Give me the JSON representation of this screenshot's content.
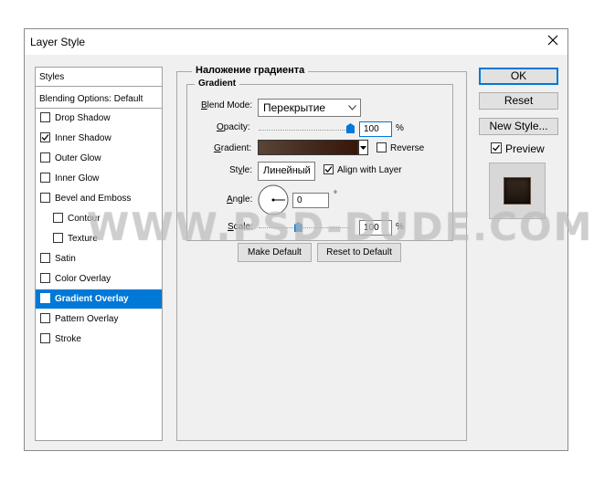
{
  "window": {
    "title": "Layer Style"
  },
  "sidebar": {
    "header": "Styles",
    "blending": "Blending Options: Default",
    "items": [
      {
        "label": "Drop Shadow",
        "checked": false,
        "selected": false,
        "indent": false
      },
      {
        "label": "Inner Shadow",
        "checked": true,
        "selected": false,
        "indent": false
      },
      {
        "label": "Outer Glow",
        "checked": false,
        "selected": false,
        "indent": false
      },
      {
        "label": "Inner Glow",
        "checked": false,
        "selected": false,
        "indent": false
      },
      {
        "label": "Bevel and Emboss",
        "checked": false,
        "selected": false,
        "indent": false
      },
      {
        "label": "Contour",
        "checked": false,
        "selected": false,
        "indent": true
      },
      {
        "label": "Texture",
        "checked": false,
        "selected": false,
        "indent": true
      },
      {
        "label": "Satin",
        "checked": false,
        "selected": false,
        "indent": false
      },
      {
        "label": "Color Overlay",
        "checked": false,
        "selected": false,
        "indent": false
      },
      {
        "label": "Gradient Overlay",
        "checked": true,
        "selected": true,
        "indent": false
      },
      {
        "label": "Pattern Overlay",
        "checked": false,
        "selected": false,
        "indent": false
      },
      {
        "label": "Stroke",
        "checked": false,
        "selected": false,
        "indent": false
      }
    ]
  },
  "panel": {
    "title": "Наложение градиента",
    "group_title": "Gradient",
    "blend_mode": {
      "label": "Blend Mode:",
      "value": "Перекрытие"
    },
    "opacity": {
      "label": "Opacity:",
      "value": "100",
      "unit": "%",
      "fraction": 1.0
    },
    "gradient": {
      "label": "Gradient:",
      "reverse_label": "Reverse",
      "reverse": false
    },
    "style": {
      "label": "Style:",
      "value": "Линейный",
      "align_label": "Align with Layer",
      "align": true
    },
    "angle": {
      "label": "Angle:",
      "value": "0",
      "unit": "°"
    },
    "scale": {
      "label": "Scale:",
      "value": "100",
      "unit": "%",
      "fraction": 0.43
    },
    "make_default": "Make Default",
    "reset_default": "Reset to Default"
  },
  "buttons": {
    "ok": "OK",
    "reset": "Reset",
    "new_style": "New Style...",
    "preview": "Preview",
    "preview_checked": true
  },
  "watermark": "WWW.PSD-DUDE.COM",
  "colors": {
    "accent": "#0078d7",
    "gradient_start": "#5a4536",
    "gradient_end": "#3a1608"
  }
}
